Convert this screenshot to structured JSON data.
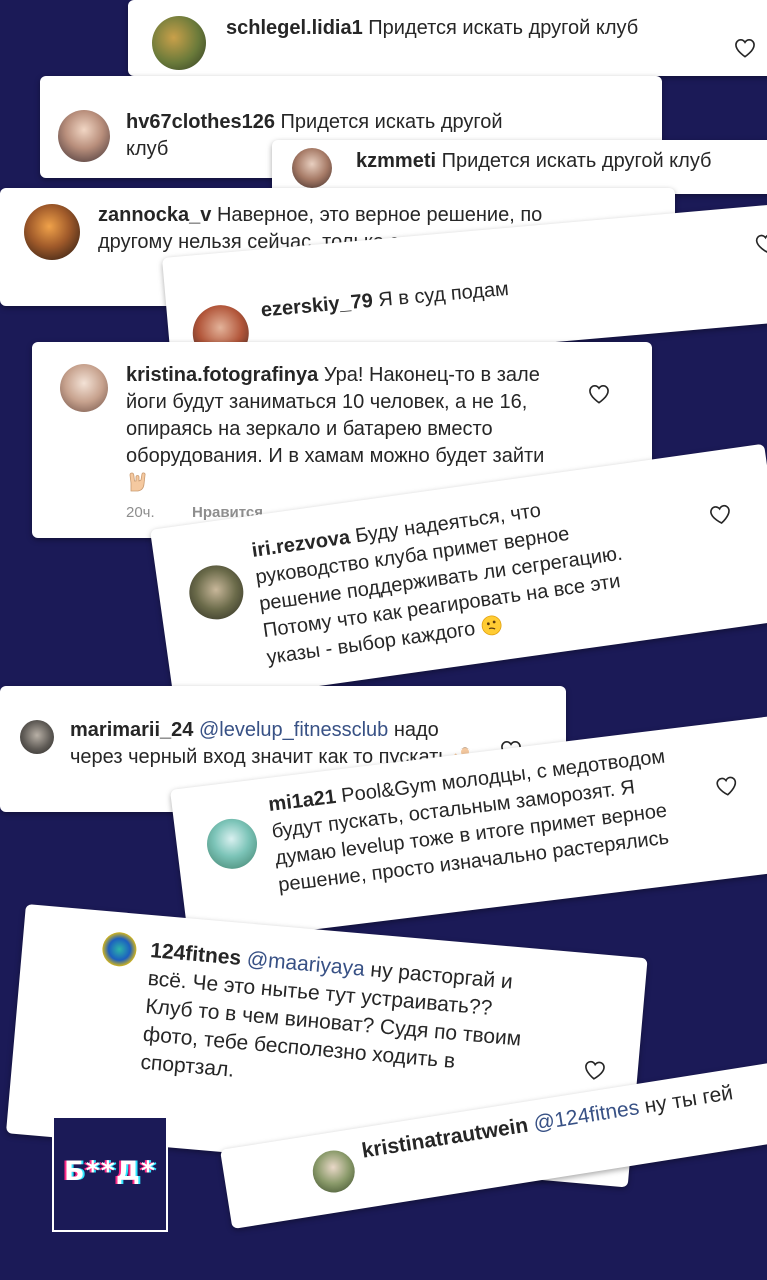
{
  "comments": [
    {
      "user": "schlegel.lidia1",
      "text": "Придется искать другой клуб"
    },
    {
      "user": "hv67clothes126",
      "text": "Придется искать другой клуб"
    },
    {
      "user": "kzmmeti",
      "text": "Придется искать другой клуб"
    },
    {
      "user": "zannocka_v",
      "text": "Наверное, это верное решение, по другому нельзя сейчас. только с кодом"
    },
    {
      "user": "ezerskiy_79",
      "text": "Я в суд подам"
    },
    {
      "user": "kristina.fotografinya",
      "text": "Ура! Наконец-то в зале йоги будут заниматься 10 человек, а не 16, опираясь на зеркало и батарею вместо оборудования. И в хамам можно будет зайти",
      "time": "20ч.",
      "like_label": "Нравится"
    },
    {
      "user": "iri.rezvova",
      "text": "Буду надеяться, что руководство клуба примет верное решение поддерживать ли сегрегацию. Потому что как реагировать на все эти указы - выбор каждого"
    },
    {
      "user": "marimarii_24",
      "mention": "@levelup_fitnessclub",
      "text": "надо через черный вход значит как то пускать"
    },
    {
      "user": "mi1a21",
      "text": "Pool&Gym молодцы, с медотводом будут пускать, остальным заморозят. Я думаю levelup тоже в итоге примет верное решение, просто изначально растерялись"
    },
    {
      "user": "124fitnes",
      "mention": "@maariyaya",
      "text": "ну расторгай и всё. Че это нытье тут устраивать?? Клуб то в чем виноват? Судя по твоим фото, тебе бесполезно ходить в спортзал."
    },
    {
      "user": "kristinatrautwein",
      "mention": "@124fitnes",
      "text": "ну ты гей"
    }
  ],
  "logo": {
    "text": "Б**Д*"
  },
  "colors": {
    "background": "#1b1a57",
    "card": "#ffffff",
    "text": "#262626",
    "mention": "#385185",
    "meta": "#8e8e8e"
  }
}
